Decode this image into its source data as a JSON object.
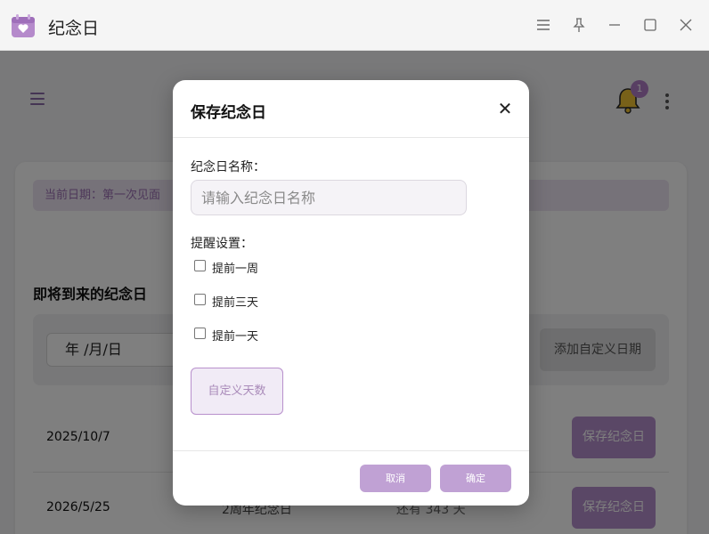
{
  "window": {
    "title": "纪念日",
    "icon": "calendar-heart-icon",
    "accent": "#b07cc6"
  },
  "header": {
    "notification_count": "1"
  },
  "main": {
    "current_date_text": "当前日期：第一次见面",
    "section_title": "即将到来的纪念日",
    "date_input_value": "年 /月/日",
    "add_custom_date_label": "添加自定义日期",
    "rows": [
      {
        "date": "2025/10/7",
        "name": "",
        "remaining": "",
        "save_label": "保存纪念日"
      },
      {
        "date": "2026/5/25",
        "name": "2周年纪念日",
        "remaining": "还有 343 天",
        "save_label": "保存纪念日"
      }
    ]
  },
  "modal": {
    "title": "保存纪念日",
    "name_label": "纪念日名称：",
    "name_placeholder": "请输入纪念日名称",
    "name_value": "",
    "reminder_label": "提醒设置：",
    "reminders": [
      {
        "label": "提前一周",
        "checked": false
      },
      {
        "label": "提前三天",
        "checked": false
      },
      {
        "label": "提前一天",
        "checked": false
      }
    ],
    "custom_days_label": "自定义天数",
    "cancel_label": "取消",
    "confirm_label": "确定"
  }
}
